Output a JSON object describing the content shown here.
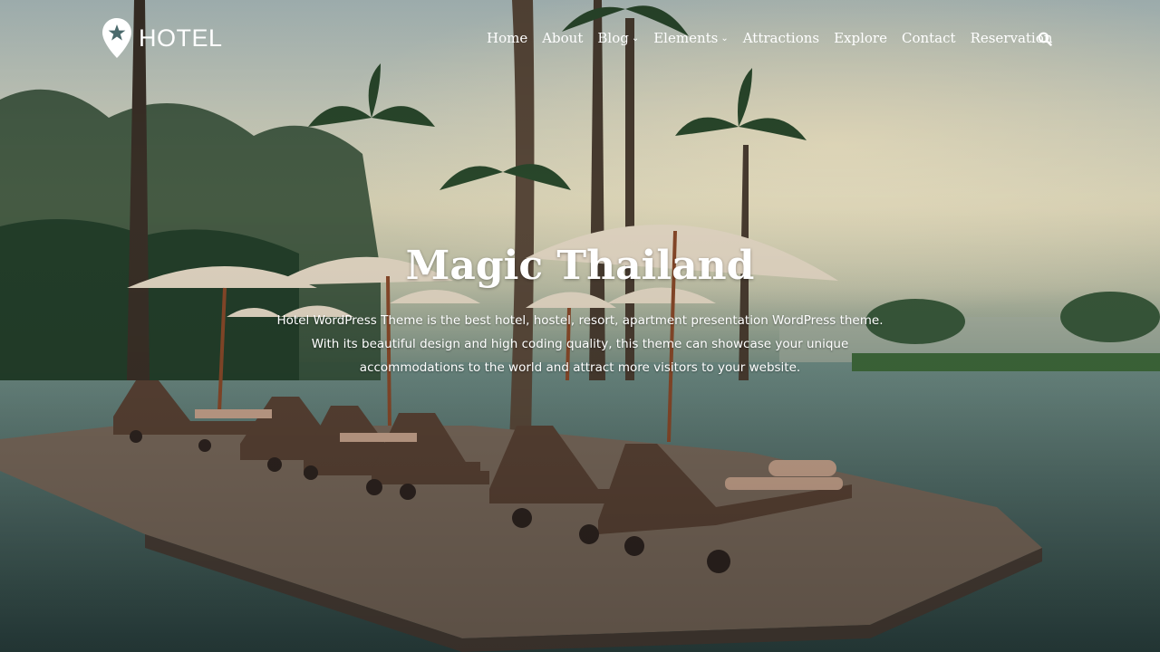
{
  "brand": {
    "name": "HOTEL"
  },
  "nav": {
    "items": [
      {
        "label": "Home",
        "dropdown": false
      },
      {
        "label": "About",
        "dropdown": false
      },
      {
        "label": "Blog",
        "dropdown": true
      },
      {
        "label": "Elements",
        "dropdown": true
      },
      {
        "label": "Attractions",
        "dropdown": false
      },
      {
        "label": "Explore",
        "dropdown": false
      },
      {
        "label": "Contact",
        "dropdown": false
      },
      {
        "label": "Reservation",
        "dropdown": false
      }
    ],
    "search_icon": "search-icon",
    "caret_glyph": "⌄"
  },
  "hero": {
    "title": "Magic Thailand",
    "description": "Hotel WordPress Theme is the best hotel, hostel, resort, apartment presentation WordPress theme. With its beautiful design and high coding quality, this theme can showcase your unique accommodations to the world and attract more visitors to your website."
  },
  "colors": {
    "text": "#ffffff",
    "water": "#3b5a58",
    "deck": "#7a6a5c",
    "umbrella": "#e8dcc8"
  }
}
